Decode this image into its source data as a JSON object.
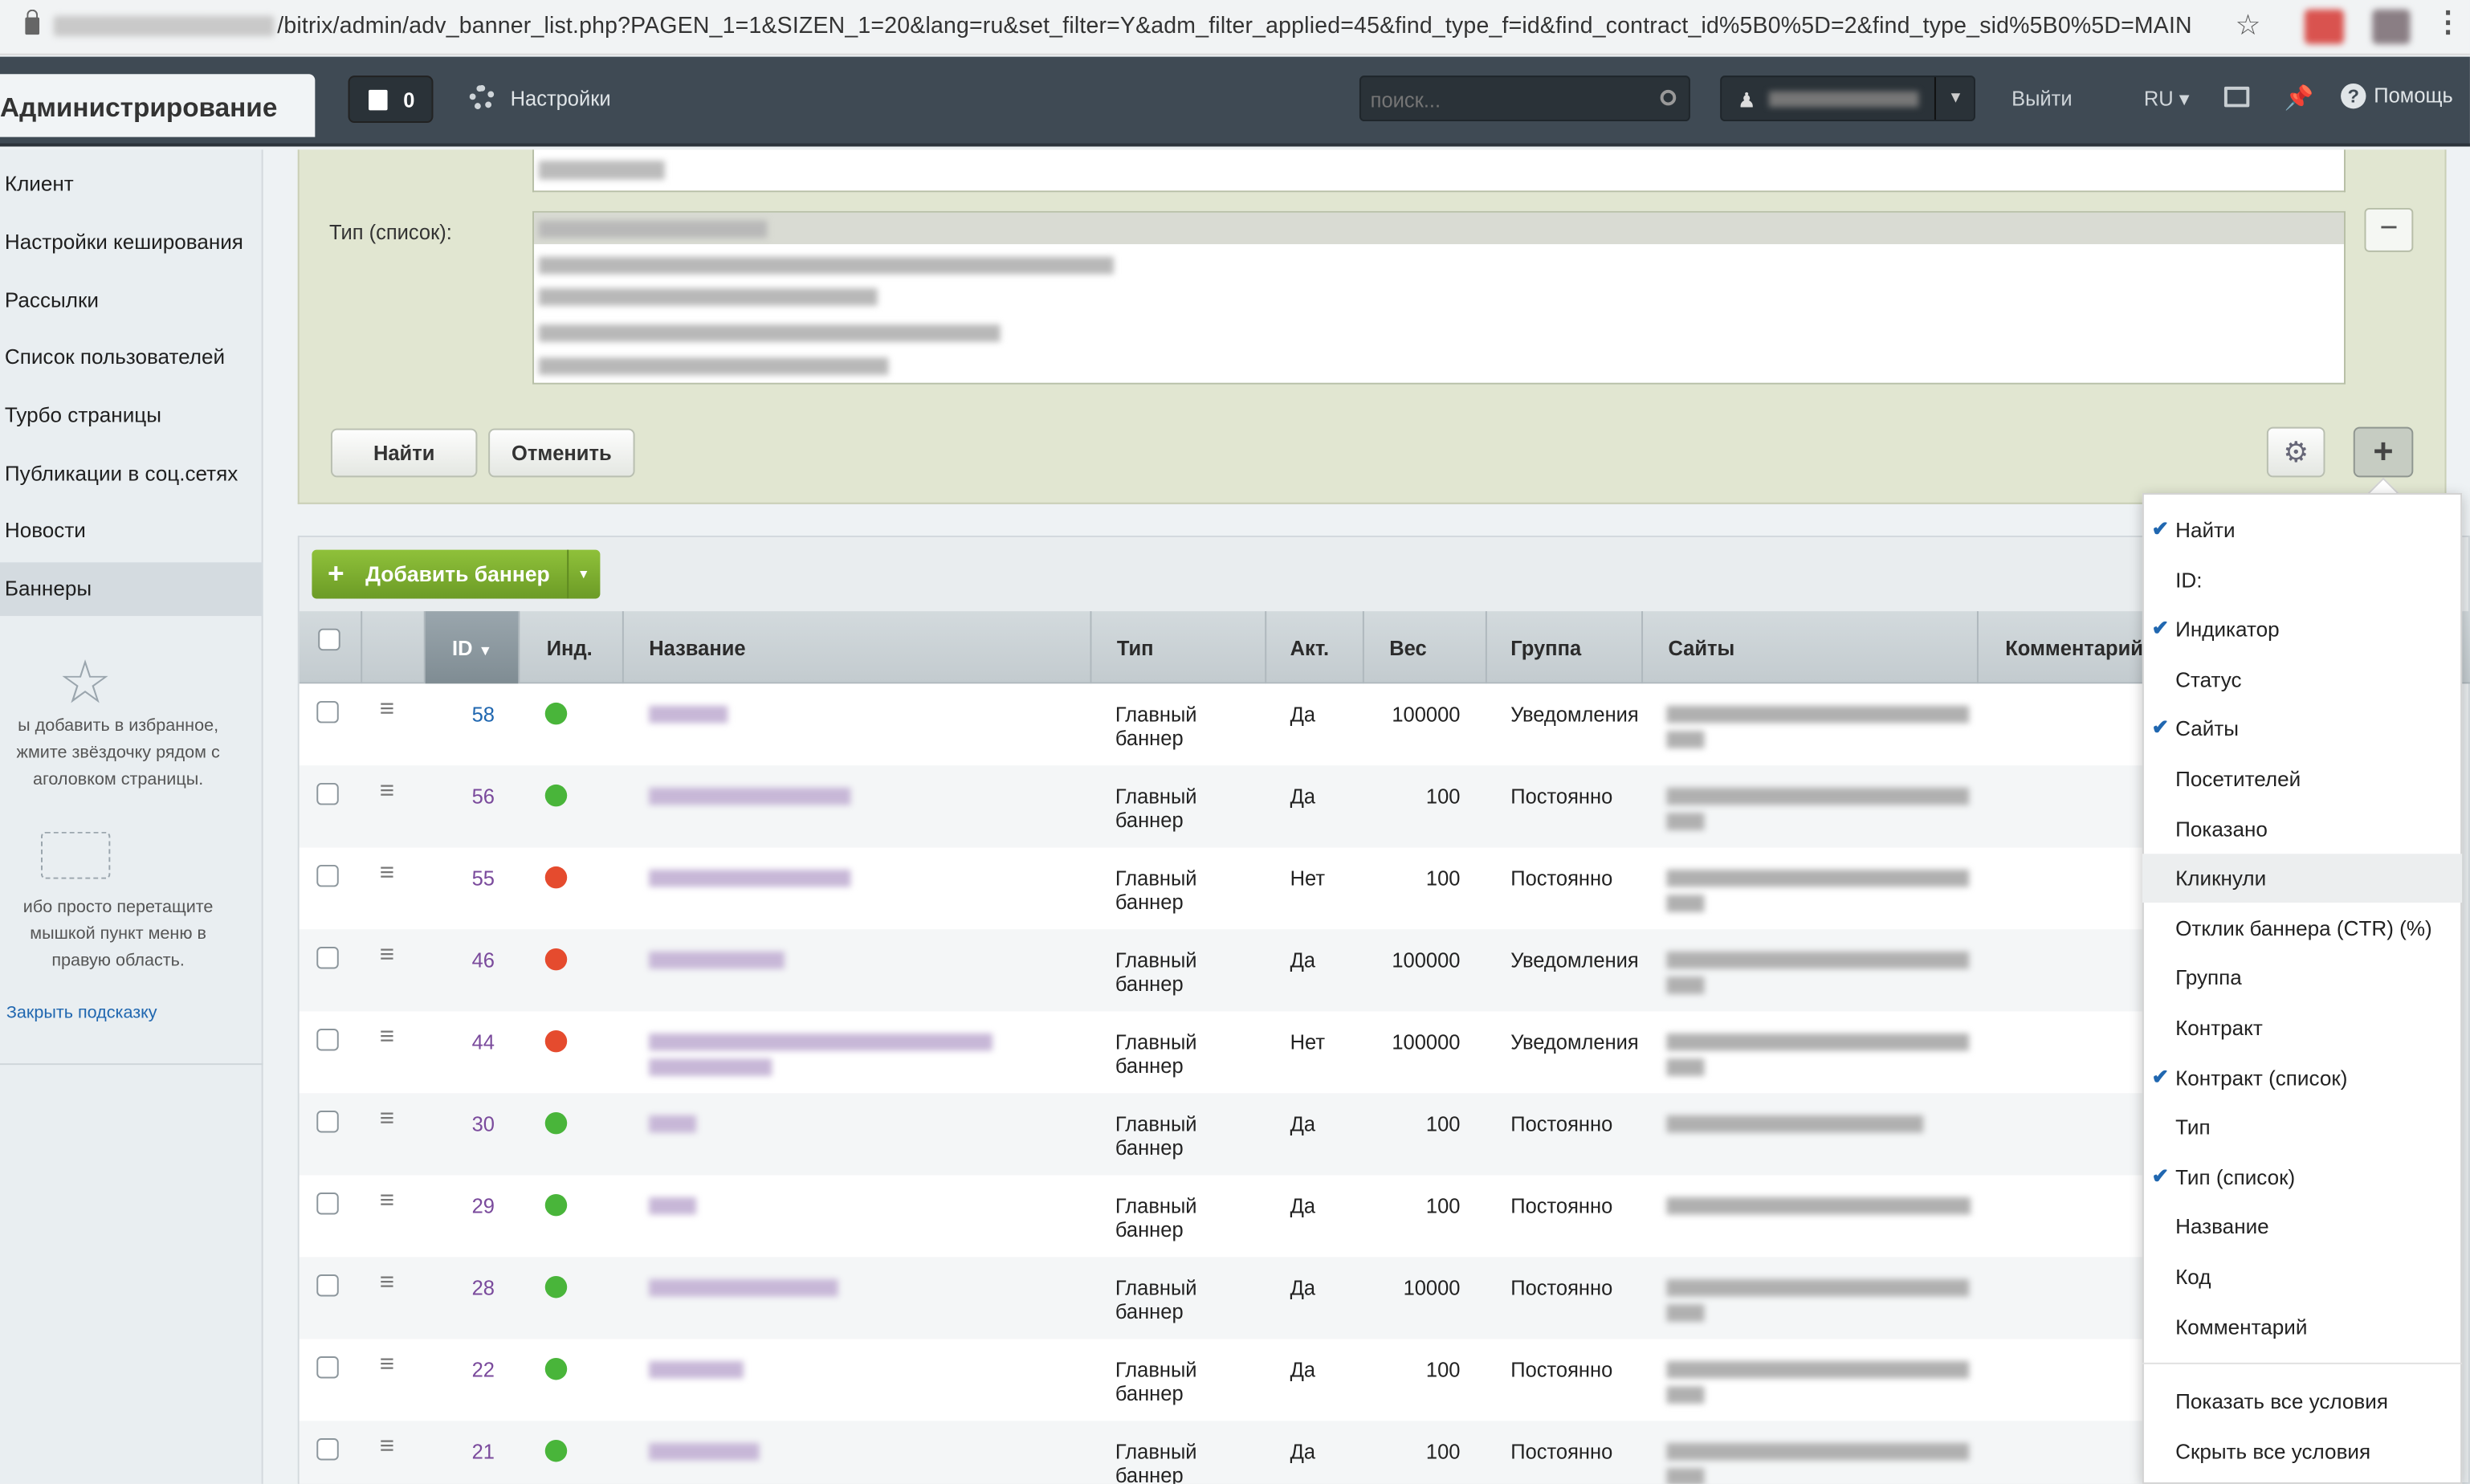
{
  "browser": {
    "url_visible": "/bitrix/admin/adv_banner_list.php?PAGEN_1=1&SIZEN_1=20&lang=ru&set_filter=Y&adm_filter_applied=45&find_type_f=id&find_contract_id%5B0%5D=2&find_type_sid%5B0%5D=MAIN"
  },
  "panel": {
    "brand": "Администрирование",
    "notifications_count": "0",
    "settings_label": "Настройки",
    "search_placeholder": "поиск...",
    "logout_label": "Выйти",
    "lang_label": "RU",
    "help_label": "Помощь"
  },
  "sidebar": {
    "items": [
      {
        "label": "Клиент"
      },
      {
        "label": "Настройки кеширования"
      },
      {
        "label": "Рассылки"
      },
      {
        "label": "Список пользователей"
      },
      {
        "label": "Турбо страницы"
      },
      {
        "label": "Публикации в соц.сетях"
      },
      {
        "label": "Новости"
      },
      {
        "label": "Баннеры",
        "active": true
      }
    ],
    "hint_fav_1": "ы добавить в избранное,",
    "hint_fav_2": "жмите звёздочку рядом с",
    "hint_fav_3": "аголовком страницы.",
    "hint_drag_1": "ибо просто перетащите",
    "hint_drag_2": "мышкой пункт меню в",
    "hint_drag_3": "правую область.",
    "close_hint": "Закрыть подсказку"
  },
  "filter": {
    "type_list_label": "Тип (список):",
    "find_button": "Найти",
    "cancel_button": "Отменить",
    "minus": "−",
    "plus": "+"
  },
  "list": {
    "add_button": "Добавить баннер",
    "columns": {
      "id": "ID",
      "ind": "Инд.",
      "name": "Название",
      "type": "Тип",
      "active": "Акт.",
      "weight": "Вес",
      "group": "Группа",
      "sites": "Сайты",
      "comment": "Комментарий"
    },
    "rows": [
      {
        "id": "58",
        "ind": "green",
        "type_1": "Главный",
        "type_2": "баннер",
        "active": "Да",
        "weight": "100000",
        "group": "Уведомления"
      },
      {
        "id": "56",
        "ind": "green",
        "type_1": "Главный",
        "type_2": "баннер",
        "active": "Да",
        "weight": "100",
        "group": "Постоянно"
      },
      {
        "id": "55",
        "ind": "red",
        "type_1": "Главный",
        "type_2": "баннер",
        "active": "Нет",
        "weight": "100",
        "group": "Постоянно"
      },
      {
        "id": "46",
        "ind": "red",
        "type_1": "Главный",
        "type_2": "баннер",
        "active": "Да",
        "weight": "100000",
        "group": "Уведомления"
      },
      {
        "id": "44",
        "ind": "red",
        "type_1": "Главный",
        "type_2": "баннер",
        "active": "Нет",
        "weight": "100000",
        "group": "Уведомления"
      },
      {
        "id": "30",
        "ind": "green",
        "type_1": "Главный",
        "type_2": "баннер",
        "active": "Да",
        "weight": "100",
        "group": "Постоянно"
      },
      {
        "id": "29",
        "ind": "green",
        "type_1": "Главный",
        "type_2": "баннер",
        "active": "Да",
        "weight": "100",
        "group": "Постоянно"
      },
      {
        "id": "28",
        "ind": "green",
        "type_1": "Главный",
        "type_2": "баннер",
        "active": "Да",
        "weight": "10000",
        "group": "Постоянно"
      },
      {
        "id": "22",
        "ind": "green",
        "type_1": "Главный",
        "type_2": "баннер",
        "active": "Да",
        "weight": "100",
        "group": "Постоянно"
      },
      {
        "id": "21",
        "ind": "green",
        "type_1": "Главный",
        "type_2": "баннер",
        "active": "Да",
        "weight": "100",
        "group": "Постоянно"
      }
    ]
  },
  "dropdown": {
    "items": [
      {
        "label": "Найти",
        "checked": true
      },
      {
        "label": "ID:",
        "checked": false
      },
      {
        "label": "Индикатор",
        "checked": true
      },
      {
        "label": "Статус",
        "checked": false
      },
      {
        "label": "Сайты",
        "checked": true
      },
      {
        "label": "Посетителей",
        "checked": false
      },
      {
        "label": "Показано",
        "checked": false
      },
      {
        "label": "Кликнули",
        "checked": false,
        "highlighted": true
      },
      {
        "label": "Отклик баннера (CTR) (%)",
        "checked": false
      },
      {
        "label": "Группа",
        "checked": false
      },
      {
        "label": "Контракт",
        "checked": false
      },
      {
        "label": "Контракт (список)",
        "checked": true
      },
      {
        "label": "Тип",
        "checked": false
      },
      {
        "label": "Тип (список)",
        "checked": true
      },
      {
        "label": "Название",
        "checked": false
      },
      {
        "label": "Код",
        "checked": false
      },
      {
        "label": "Комментарий",
        "checked": false
      }
    ],
    "show_all": "Показать все условия",
    "hide_all": "Скрыть все условия"
  },
  "colors": {
    "panel_bg": "#3f4a54",
    "filter_bg": "#e1e6d1",
    "add_button": "#7cad2e",
    "link": "#2067b0",
    "indicator_green": "#49b53a",
    "indicator_red": "#e54b2e"
  }
}
